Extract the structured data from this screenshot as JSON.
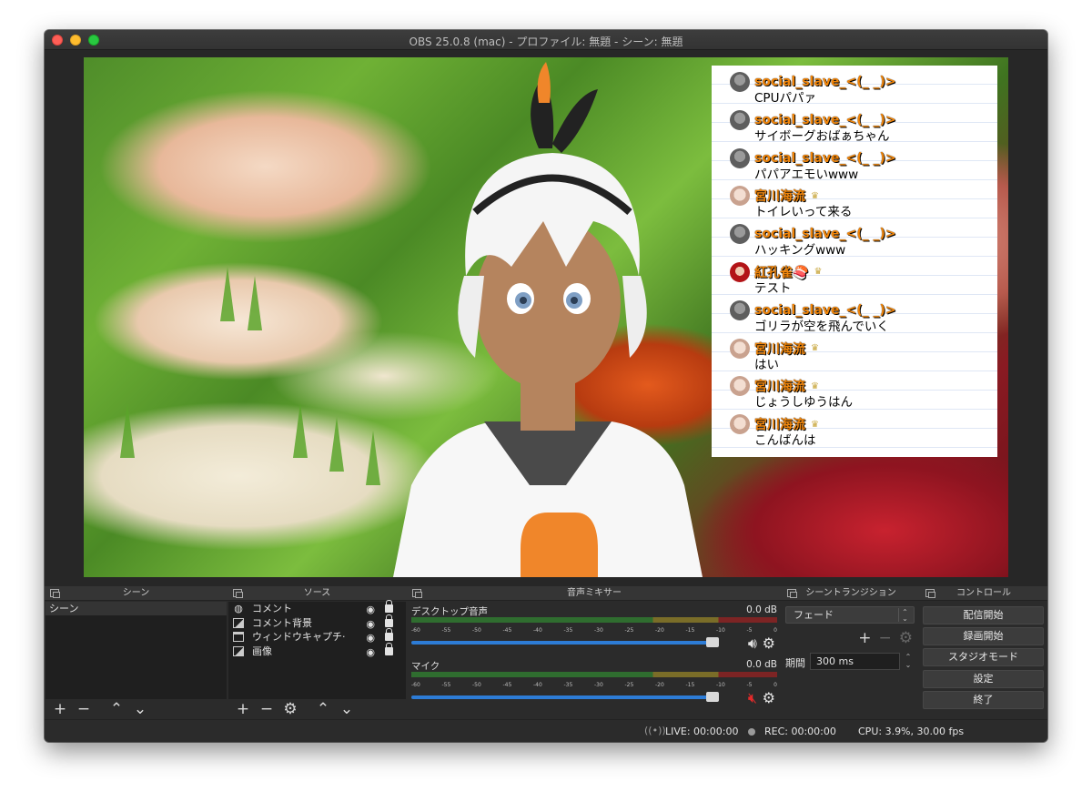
{
  "window": {
    "title": "OBS 25.0.8 (mac) - プロファイル: 無題 - シーン: 無題"
  },
  "chat": {
    "messages": [
      {
        "user": "social_slave_<(_ _)>",
        "text": "CPUパパァ",
        "avatar": "grey"
      },
      {
        "user": "social_slave_<(_ _)>",
        "text": "サイボーグおばぁちゃん",
        "avatar": "grey"
      },
      {
        "user": "social_slave_<(_ _)>",
        "text": "パパアエモいwww",
        "avatar": "grey"
      },
      {
        "user": "宮川海流",
        "text": "トイレいって来る",
        "avatar": "girl"
      },
      {
        "user": "social_slave_<(_ _)>",
        "text": "ハッキングwww",
        "avatar": "grey"
      },
      {
        "user": "紅孔雀🍣",
        "text": "テスト",
        "avatar": "red"
      },
      {
        "user": "social_slave_<(_ _)>",
        "text": "ゴリラが空を飛んでいく",
        "avatar": "grey"
      },
      {
        "user": "宮川海流",
        "text": "はい",
        "avatar": "girl"
      },
      {
        "user": "宮川海流",
        "text": "じょうしゆうはん",
        "avatar": "girl"
      },
      {
        "user": "宮川海流",
        "text": "こんばんは",
        "avatar": "girl"
      }
    ]
  },
  "docks": {
    "scenes": {
      "title": "シーン",
      "items": [
        "シーン"
      ]
    },
    "sources": {
      "title": "ソース",
      "items": [
        {
          "label": "コメント",
          "icon": "globe-icon"
        },
        {
          "label": "コメント背景",
          "icon": "image-icon"
        },
        {
          "label": "ウィンドウキャプチ·",
          "icon": "window-icon"
        },
        {
          "label": "画像",
          "icon": "image-icon"
        }
      ]
    },
    "mixer": {
      "title": "音声ミキサー",
      "channels": [
        {
          "name": "デスクトップ音声",
          "db": "0.0 dB",
          "volume": 0.95,
          "muted": false
        },
        {
          "name": "マイク",
          "db": "0.0 dB",
          "volume": 0.95,
          "muted": true
        }
      ],
      "ticks": [
        "-60",
        "-55",
        "-50",
        "-45",
        "-40",
        "-35",
        "-30",
        "-25",
        "-20",
        "-15",
        "-10",
        "-5",
        "0"
      ]
    },
    "transitions": {
      "title": "シーントランジション",
      "selected": "フェード",
      "duration_label": "期間",
      "duration_value": "300 ms"
    },
    "controls": {
      "title": "コントロール",
      "buttons": [
        "配信開始",
        "録画開始",
        "スタジオモード",
        "設定",
        "終了"
      ]
    }
  },
  "status": {
    "live": "LIVE: 00:00:00",
    "rec": "REC: 00:00:00",
    "cpu": "CPU: 3.9%, 30.00 fps"
  },
  "colors": {
    "chat_username": "#f0850a",
    "volume_bar": "#2d7cd6",
    "muted_icon": "#e32a2a",
    "window_bg": "#2b2b2b"
  }
}
